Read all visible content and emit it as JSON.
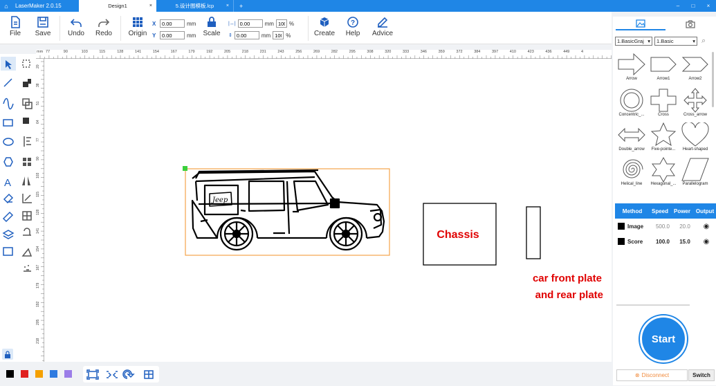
{
  "titlebar": {
    "app_name": "LaserMaker 2.0.15",
    "tabs": [
      {
        "label": "Design1",
        "active": true
      },
      {
        "label": "5.设计图模板.lcp",
        "active": false
      }
    ],
    "new_tab": "+"
  },
  "toolbar": {
    "file": "File",
    "save": "Save",
    "undo": "Undo",
    "redo": "Redo",
    "origin": "Origin",
    "x_label": "X",
    "y_label": "Y",
    "x_value": "0.00",
    "y_value": "0.00",
    "unit": "mm",
    "scale": "Scale",
    "w_value": "0.00",
    "h_value": "0.00",
    "w_pct": "100",
    "h_pct": "100",
    "pct": "%",
    "create": "Create",
    "help": "Help",
    "advice": "Advice"
  },
  "ruler": {
    "top_ticks": [
      "mm",
      "77",
      "90",
      "103",
      "115",
      "128",
      "141",
      "154",
      "167",
      "179",
      "192",
      "205",
      "218",
      "231",
      "243",
      "256",
      "269",
      "282",
      "295",
      "308",
      "320",
      "333",
      "346",
      "359",
      "372",
      "384",
      "397",
      "410",
      "423",
      "436",
      "449",
      "4"
    ],
    "left_ticks": [
      "20",
      "38",
      "51",
      "64",
      "77",
      "90",
      "103",
      "115",
      "128",
      "141",
      "154",
      "167",
      "179",
      "192",
      "205",
      "218"
    ]
  },
  "canvas": {
    "chassis_label": "Chassis",
    "front_plate_label_1": "car front plate",
    "front_plate_label_2": "and rear plate",
    "jeep_text": "Jeep"
  },
  "library": {
    "category": "1.BasicGraj",
    "subcategory": "1.Basic",
    "shapes": [
      {
        "name": "Arrow"
      },
      {
        "name": "Arrow1"
      },
      {
        "name": "Arrow2"
      },
      {
        "name": "Concentric_..."
      },
      {
        "name": "Cross"
      },
      {
        "name": "Cross_arrow"
      },
      {
        "name": "Double_arrow"
      },
      {
        "name": "Five-pointe..."
      },
      {
        "name": "Heart-shaped"
      },
      {
        "name": "Helical_line"
      },
      {
        "name": "Hexagonal_..."
      },
      {
        "name": "Parallelogram"
      }
    ]
  },
  "layers": {
    "headers": [
      "Method",
      "Speed",
      "Power",
      "Output"
    ],
    "rows": [
      {
        "method": "Image",
        "speed": "500.0",
        "power": "20.0",
        "color": "#000000"
      },
      {
        "method": "Score",
        "speed": "100.0",
        "power": "15.0",
        "color": "#000000"
      }
    ]
  },
  "start_label": "Start",
  "disconnect_label": "Disconnect",
  "switch_label": "Switch",
  "swatches": [
    "#000000",
    "#e02020",
    "#f5a000",
    "#2f7be0",
    "#9b7de8"
  ],
  "colors": {
    "accent": "#1f86e6",
    "red_text": "#e00000",
    "selection": "#f5a34a"
  }
}
